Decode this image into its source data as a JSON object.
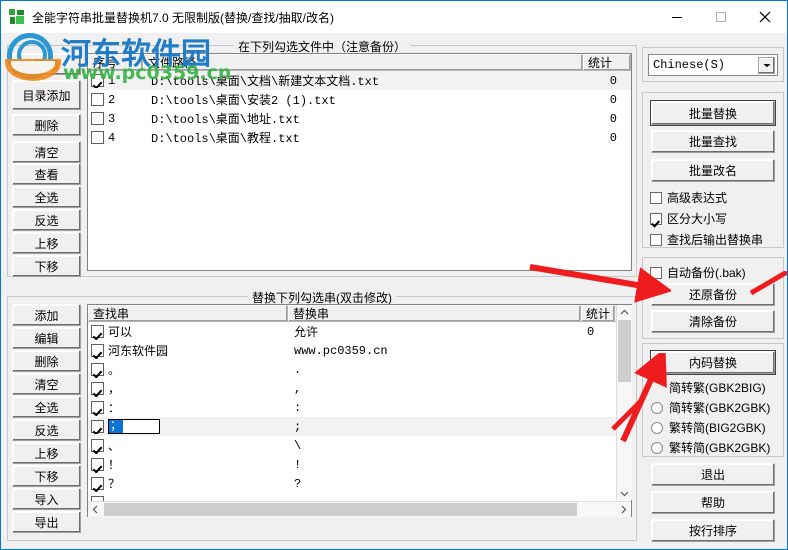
{
  "window": {
    "title": "全能字符串批量替换机7.0 无限制版(替换/查找/抽取/改名)",
    "minimize_label": "minimize",
    "maximize_label": "maximize",
    "close_label": "close"
  },
  "watermark": {
    "site_name": "河东软件园",
    "site_url": "www.pc0359.cn"
  },
  "file_group": {
    "title": "在下列勾选文件中（注意备份）",
    "columns": [
      "序号",
      "文件路径",
      "统计"
    ],
    "rows": [
      {
        "checked": true,
        "index": "1",
        "path": "D:\\tools\\桌面\\文档\\新建文本文档.txt",
        "count": "0"
      },
      {
        "checked": false,
        "index": "2",
        "path": "D:\\tools\\桌面\\安装2 (1).txt",
        "count": "0"
      },
      {
        "checked": false,
        "index": "3",
        "path": "D:\\tools\\桌面\\地址.txt",
        "count": "0"
      },
      {
        "checked": false,
        "index": "4",
        "path": "D:\\tools\\桌面\\教程.txt",
        "count": "0"
      }
    ]
  },
  "file_buttons": [
    {
      "label": "添加"
    },
    {
      "label": "目录添加"
    },
    {
      "label": "删除"
    },
    {
      "label": "清空"
    },
    {
      "label": "查看"
    },
    {
      "label": "全选"
    },
    {
      "label": "反选"
    },
    {
      "label": "上移"
    },
    {
      "label": "下移"
    }
  ],
  "replace_group": {
    "title": "替换下列勾选串(双击修改)",
    "columns": [
      "查找串",
      "替换串",
      "统计"
    ],
    "rows": [
      {
        "checked": true,
        "find": "可以",
        "replace": "允许",
        "count": "0",
        "editing": false
      },
      {
        "checked": true,
        "find": "河东软件园",
        "replace": "www.pc0359.cn",
        "count": "",
        "editing": false
      },
      {
        "checked": true,
        "find": "。",
        "replace": ".",
        "count": "",
        "editing": false
      },
      {
        "checked": true,
        "find": "，",
        "replace": ",",
        "count": "",
        "editing": false
      },
      {
        "checked": true,
        "find": "：",
        "replace": ":",
        "count": "",
        "editing": false
      },
      {
        "checked": true,
        "find": "；",
        "replace": ";",
        "count": "",
        "editing": true
      },
      {
        "checked": true,
        "find": "、",
        "replace": "\\",
        "count": "",
        "editing": false
      },
      {
        "checked": true,
        "find": "！",
        "replace": "!",
        "count": "",
        "editing": false
      },
      {
        "checked": true,
        "find": "？",
        "replace": "?",
        "count": "",
        "editing": false
      },
      {
        "checked": true,
        "find": "—",
        "replace": "-",
        "count": "",
        "editing": false
      },
      {
        "checked": true,
        "find": "“",
        "replace": "\"",
        "count": "",
        "editing": false
      }
    ]
  },
  "replace_buttons": [
    {
      "label": "添加"
    },
    {
      "label": "编辑"
    },
    {
      "label": "删除"
    },
    {
      "label": "清空"
    },
    {
      "label": "全选"
    },
    {
      "label": "反选"
    },
    {
      "label": "上移"
    },
    {
      "label": "下移"
    },
    {
      "label": "导入"
    },
    {
      "label": "导出"
    }
  ],
  "language": {
    "selected": "Chinese(S)"
  },
  "actions": {
    "batch_replace": "批量替换",
    "batch_find": "批量查找",
    "batch_rename": "批量改名",
    "options": [
      {
        "label": "高级表达式",
        "checked": false
      },
      {
        "label": "区分大小写",
        "checked": true
      },
      {
        "label": "查找后输出替换串",
        "checked": false
      }
    ]
  },
  "backup": {
    "auto_backup": {
      "label": "自动备份(.bak)",
      "checked": false
    },
    "restore": "还原备份",
    "clear": "清除备份"
  },
  "encoding": {
    "button": "内码替换",
    "options": [
      {
        "label": "简转繁(GBK2BIG)",
        "selected": false
      },
      {
        "label": "简转繁(GBK2GBK)",
        "selected": false
      },
      {
        "label": "繁转简(BIG2GBK)",
        "selected": false
      },
      {
        "label": "繁转简(GBK2GBK)",
        "selected": false
      }
    ]
  },
  "footer_buttons": [
    {
      "label": "退出"
    },
    {
      "label": "帮助"
    },
    {
      "label": "按行排序"
    }
  ],
  "colors": {
    "accent": "#0078d7",
    "annotation": "#ee1c1c",
    "selection": "#0a74d8",
    "watermark_blue": "#1677c4",
    "watermark_green": "#3cb54a"
  }
}
